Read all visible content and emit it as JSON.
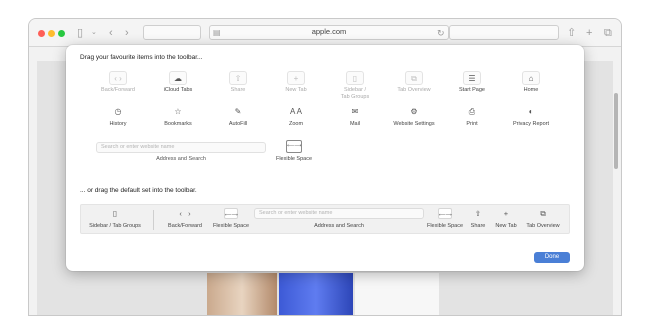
{
  "browser": {
    "address": "apple.com"
  },
  "sheet": {
    "heading_favourites": "Drag your favourite items into the toolbar...",
    "heading_default": "... or drag the default set into the toolbar.",
    "items_row1": [
      {
        "label": "Back/Forward",
        "glyph": "‹ ›",
        "dim": true
      },
      {
        "label": "iCloud Tabs",
        "glyph": "☁",
        "dim": false
      },
      {
        "label": "Share",
        "glyph": "⇧",
        "dim": true
      },
      {
        "label": "New Tab",
        "glyph": "+",
        "dim": true
      },
      {
        "label": "Sidebar /\nTab Groups",
        "glyph": "▯",
        "dim": true
      },
      {
        "label": "Tab Overview",
        "glyph": "⧉",
        "dim": true
      },
      {
        "label": "Start Page",
        "glyph": "☰",
        "dim": false
      },
      {
        "label": "Home",
        "glyph": "⌂",
        "dim": false
      }
    ],
    "items_row2": [
      {
        "label": "History",
        "glyph": "◷"
      },
      {
        "label": "Bookmarks",
        "glyph": "☆"
      },
      {
        "label": "AutoFill",
        "glyph": "✎"
      },
      {
        "label": "Zoom",
        "glyph": "A A"
      },
      {
        "label": "Mail",
        "glyph": "✉"
      },
      {
        "label": "Website Settings",
        "glyph": "⚙"
      },
      {
        "label": "Print",
        "glyph": "⎙"
      },
      {
        "label": "Privacy Report",
        "glyph": "◐"
      }
    ],
    "search_placeholder": "Search or enter website name",
    "search_label": "Address and Search",
    "flex_label": "Flexible Space",
    "flex_glyph": "⟵⟶",
    "default_set": {
      "sidebar": "Sidebar / Tab Groups",
      "back_forward": "Back/Forward",
      "flexible_space_left": "Flexible Space",
      "address_placeholder": "Search or enter website name",
      "address_label": "Address and Search",
      "flexible_space_right": "Flexible Space",
      "share": "Share",
      "new_tab": "New Tab",
      "tab_overview": "Tab Overview"
    },
    "done_label": "Done"
  },
  "colors": {
    "accent": "#4a7fd6",
    "traffic_red": "#fe5f57",
    "traffic_yellow": "#febc2e",
    "traffic_green": "#28c840"
  }
}
